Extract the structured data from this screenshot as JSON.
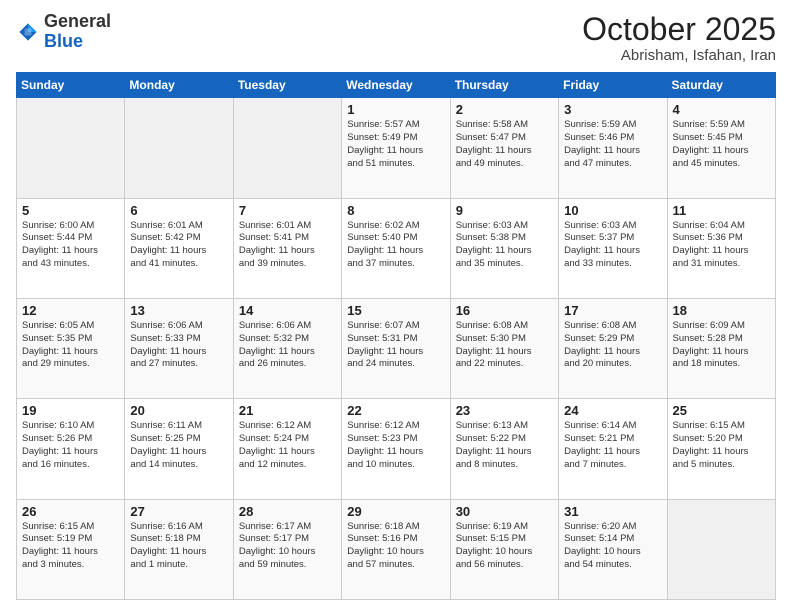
{
  "header": {
    "logo_line1": "General",
    "logo_line2": "Blue",
    "month": "October 2025",
    "location": "Abrisham, Isfahan, Iran"
  },
  "weekdays": [
    "Sunday",
    "Monday",
    "Tuesday",
    "Wednesday",
    "Thursday",
    "Friday",
    "Saturday"
  ],
  "weeks": [
    [
      {
        "day": "",
        "text": ""
      },
      {
        "day": "",
        "text": ""
      },
      {
        "day": "",
        "text": ""
      },
      {
        "day": "1",
        "text": "Sunrise: 5:57 AM\nSunset: 5:49 PM\nDaylight: 11 hours\nand 51 minutes."
      },
      {
        "day": "2",
        "text": "Sunrise: 5:58 AM\nSunset: 5:47 PM\nDaylight: 11 hours\nand 49 minutes."
      },
      {
        "day": "3",
        "text": "Sunrise: 5:59 AM\nSunset: 5:46 PM\nDaylight: 11 hours\nand 47 minutes."
      },
      {
        "day": "4",
        "text": "Sunrise: 5:59 AM\nSunset: 5:45 PM\nDaylight: 11 hours\nand 45 minutes."
      }
    ],
    [
      {
        "day": "5",
        "text": "Sunrise: 6:00 AM\nSunset: 5:44 PM\nDaylight: 11 hours\nand 43 minutes."
      },
      {
        "day": "6",
        "text": "Sunrise: 6:01 AM\nSunset: 5:42 PM\nDaylight: 11 hours\nand 41 minutes."
      },
      {
        "day": "7",
        "text": "Sunrise: 6:01 AM\nSunset: 5:41 PM\nDaylight: 11 hours\nand 39 minutes."
      },
      {
        "day": "8",
        "text": "Sunrise: 6:02 AM\nSunset: 5:40 PM\nDaylight: 11 hours\nand 37 minutes."
      },
      {
        "day": "9",
        "text": "Sunrise: 6:03 AM\nSunset: 5:38 PM\nDaylight: 11 hours\nand 35 minutes."
      },
      {
        "day": "10",
        "text": "Sunrise: 6:03 AM\nSunset: 5:37 PM\nDaylight: 11 hours\nand 33 minutes."
      },
      {
        "day": "11",
        "text": "Sunrise: 6:04 AM\nSunset: 5:36 PM\nDaylight: 11 hours\nand 31 minutes."
      }
    ],
    [
      {
        "day": "12",
        "text": "Sunrise: 6:05 AM\nSunset: 5:35 PM\nDaylight: 11 hours\nand 29 minutes."
      },
      {
        "day": "13",
        "text": "Sunrise: 6:06 AM\nSunset: 5:33 PM\nDaylight: 11 hours\nand 27 minutes."
      },
      {
        "day": "14",
        "text": "Sunrise: 6:06 AM\nSunset: 5:32 PM\nDaylight: 11 hours\nand 26 minutes."
      },
      {
        "day": "15",
        "text": "Sunrise: 6:07 AM\nSunset: 5:31 PM\nDaylight: 11 hours\nand 24 minutes."
      },
      {
        "day": "16",
        "text": "Sunrise: 6:08 AM\nSunset: 5:30 PM\nDaylight: 11 hours\nand 22 minutes."
      },
      {
        "day": "17",
        "text": "Sunrise: 6:08 AM\nSunset: 5:29 PM\nDaylight: 11 hours\nand 20 minutes."
      },
      {
        "day": "18",
        "text": "Sunrise: 6:09 AM\nSunset: 5:28 PM\nDaylight: 11 hours\nand 18 minutes."
      }
    ],
    [
      {
        "day": "19",
        "text": "Sunrise: 6:10 AM\nSunset: 5:26 PM\nDaylight: 11 hours\nand 16 minutes."
      },
      {
        "day": "20",
        "text": "Sunrise: 6:11 AM\nSunset: 5:25 PM\nDaylight: 11 hours\nand 14 minutes."
      },
      {
        "day": "21",
        "text": "Sunrise: 6:12 AM\nSunset: 5:24 PM\nDaylight: 11 hours\nand 12 minutes."
      },
      {
        "day": "22",
        "text": "Sunrise: 6:12 AM\nSunset: 5:23 PM\nDaylight: 11 hours\nand 10 minutes."
      },
      {
        "day": "23",
        "text": "Sunrise: 6:13 AM\nSunset: 5:22 PM\nDaylight: 11 hours\nand 8 minutes."
      },
      {
        "day": "24",
        "text": "Sunrise: 6:14 AM\nSunset: 5:21 PM\nDaylight: 11 hours\nand 7 minutes."
      },
      {
        "day": "25",
        "text": "Sunrise: 6:15 AM\nSunset: 5:20 PM\nDaylight: 11 hours\nand 5 minutes."
      }
    ],
    [
      {
        "day": "26",
        "text": "Sunrise: 6:15 AM\nSunset: 5:19 PM\nDaylight: 11 hours\nand 3 minutes."
      },
      {
        "day": "27",
        "text": "Sunrise: 6:16 AM\nSunset: 5:18 PM\nDaylight: 11 hours\nand 1 minute."
      },
      {
        "day": "28",
        "text": "Sunrise: 6:17 AM\nSunset: 5:17 PM\nDaylight: 10 hours\nand 59 minutes."
      },
      {
        "day": "29",
        "text": "Sunrise: 6:18 AM\nSunset: 5:16 PM\nDaylight: 10 hours\nand 57 minutes."
      },
      {
        "day": "30",
        "text": "Sunrise: 6:19 AM\nSunset: 5:15 PM\nDaylight: 10 hours\nand 56 minutes."
      },
      {
        "day": "31",
        "text": "Sunrise: 6:20 AM\nSunset: 5:14 PM\nDaylight: 10 hours\nand 54 minutes."
      },
      {
        "day": "",
        "text": ""
      }
    ]
  ]
}
